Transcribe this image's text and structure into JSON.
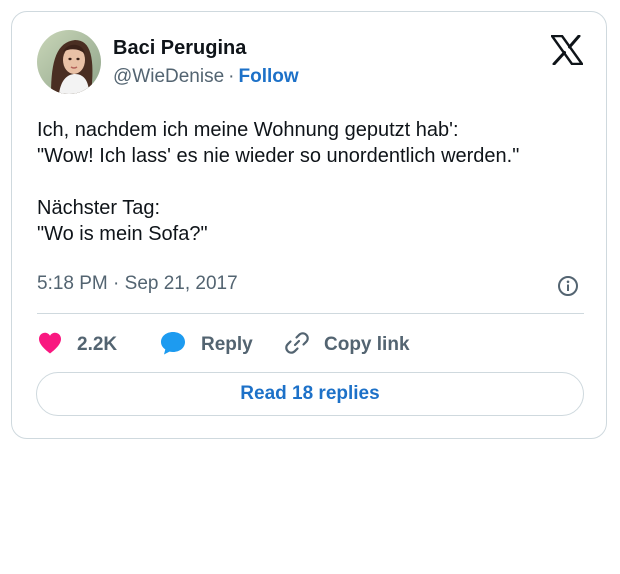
{
  "tweet": {
    "author": {
      "display_name": "Baci Perugina",
      "handle": "@WieDenise",
      "separator": "·",
      "follow_label": "Follow",
      "avatar_icon": "avatar-photo"
    },
    "brand_icon": "x-logo-icon",
    "body_lines": [
      "Ich, nachdem ich meine Wohnung geputzt hab':",
      "\"Wow! Ich lass' es nie wieder so unordentlich werden.\"",
      "",
      "Nächster Tag:",
      "\"Wo is mein Sofa?\""
    ],
    "timestamp": "5:18 PM · Sep 21, 2017",
    "info_icon": "info-icon",
    "actions": {
      "like_count": "2.2K",
      "reply_label": "Reply",
      "copy_link_label": "Copy link"
    },
    "read_replies_label": "Read 18 replies"
  },
  "colors": {
    "like": "#f91880",
    "reply": "#1d9bf0",
    "link": "#1d71c8",
    "secondary_text": "#536471",
    "border": "#cfd9de"
  }
}
